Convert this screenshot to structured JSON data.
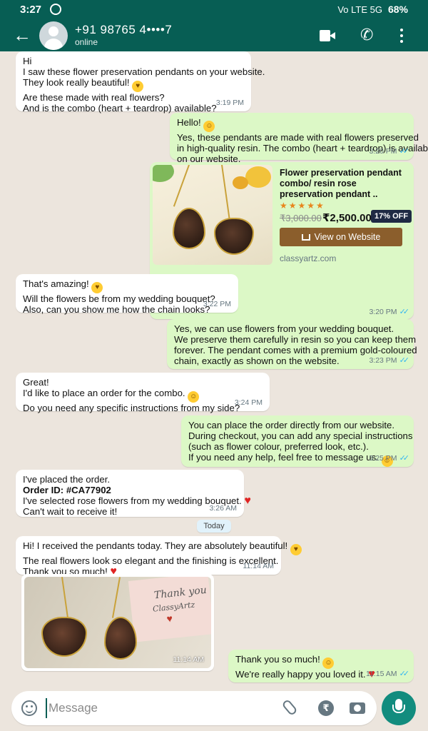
{
  "status_bar": {
    "time": "3:27",
    "network": "Vo LTE 5G",
    "battery": "68%"
  },
  "header": {
    "contact_name": "+91 98765 4••••7",
    "contact_status": "online"
  },
  "messages": [
    {
      "lines": [
        "Hi",
        "I saw these flower preservation pendants on your website.",
        "They look really beautiful!",
        "Are these made with real flowers?",
        "And is the combo (heart + teardrop) available?"
      ],
      "time": "3:19 PM"
    },
    {
      "lines": [
        "Hello!",
        "Yes, these pendants are made with real flowers preserved",
        "in high-quality resin. The combo (heart + teardrop) is available",
        "on our website."
      ],
      "time": "3:20 PM"
    },
    {
      "lines": [
        "That's amazing!",
        "Will the flowers be from my wedding bouquet?",
        "Also, can you show me how the chain looks?"
      ],
      "time": "3:22 PM"
    },
    {
      "lines": [
        "Yes, we can use flowers from your wedding bouquet.",
        "We preserve them carefully in resin so you can keep them",
        "forever. The pendant comes with a premium gold-coloured",
        "chain, exactly as shown on the website."
      ],
      "time": "3:23 PM"
    },
    {
      "lines": [
        "Great!",
        "I'd like to place an order for the combo.",
        "Do you need any specific instructions from my side?"
      ],
      "time": "3:24 PM"
    },
    {
      "lines": [
        "You can place the order directly from our website.",
        "During checkout, you can add any special instructions",
        "(such as flower colour, preferred look, etc.).",
        "If you need any help, feel free to message us."
      ],
      "time": "3:25 PM"
    },
    {
      "lines": [
        "I've placed the order.",
        "Order ID: ",
        "I've selected rose flowers from my wedding bouquet.",
        "Can't wait to receive it!"
      ],
      "order_id": "#CA77902",
      "time": "3:26 AM"
    },
    {
      "lines": [
        "Hi! I received the pendants today. They are absolutely beautiful!",
        "The real flowers look so elegant and the finishing is excellent.",
        "Thank you so much!"
      ],
      "time": "11:14 AM"
    },
    {
      "lines": [
        "Thank you so much!",
        "We're really happy you loved it."
      ],
      "time": "11:15 AM"
    }
  ],
  "product_card": {
    "title": "Flower preservation pendant combo/ resin rose preservation pendant ..",
    "stars": "★★★★★",
    "old_price": "₹3,000.00",
    "price": "₹2,500.00",
    "discount": "17% OFF",
    "button_label": "View on Website",
    "domain": "classyartz.com",
    "time": "3:20 PM"
  },
  "date_divider": "Today",
  "photo_message": {
    "card_text_1": "Thank you",
    "card_text_2": "ClassyArtz",
    "time": "11:14 AM"
  },
  "input": {
    "placeholder": "Message"
  },
  "colors": {
    "header": "#075e54",
    "outgoing": "#dcf8c6",
    "incoming": "#ffffff",
    "background": "#ece5dd",
    "ticks": "#34b7f1",
    "accent": "#128c7e"
  },
  "icons": [
    "back-arrow-icon",
    "video-call-icon",
    "phone-icon",
    "more-menu-icon",
    "emoji-icon",
    "attach-icon",
    "rupee-icon",
    "camera-icon",
    "mic-icon"
  ]
}
